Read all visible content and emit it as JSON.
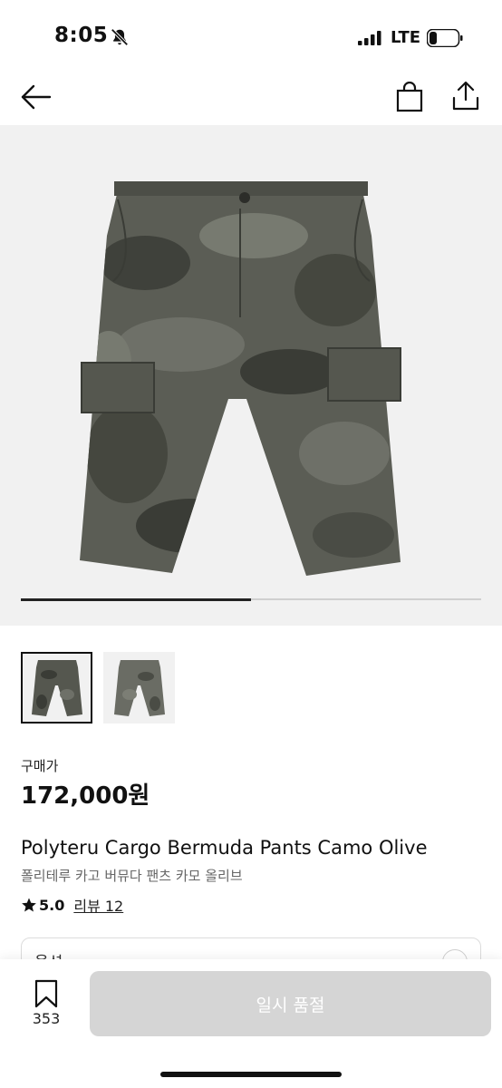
{
  "status_bar": {
    "time": "8:05",
    "network": "LTE",
    "battery_level": 0.25
  },
  "nav": {
    "back_icon": "arrow-left-icon",
    "bag_icon": "shopping-bag-icon",
    "share_icon": "share-icon"
  },
  "gallery": {
    "image_count": 2,
    "current_index": 1,
    "progress": 0.5
  },
  "price": {
    "label": "구매가",
    "value": "172,000원"
  },
  "product": {
    "name_en": "Polyteru Cargo Bermuda Pants Camo Olive",
    "name_ko": "폴리테루 카고 버뮤다 팬츠 카모 올리브",
    "rating": "5.0",
    "reviews": "리뷰 12"
  },
  "option": {
    "label": "옵션"
  },
  "bottom": {
    "wish_count": "353",
    "button_label": "일시 품절"
  },
  "colors": {
    "accent": "#111111",
    "disabled_button": "#d5d5d5",
    "hero_bg": "#f1f1f1",
    "camo_base": "#5b5d55"
  }
}
